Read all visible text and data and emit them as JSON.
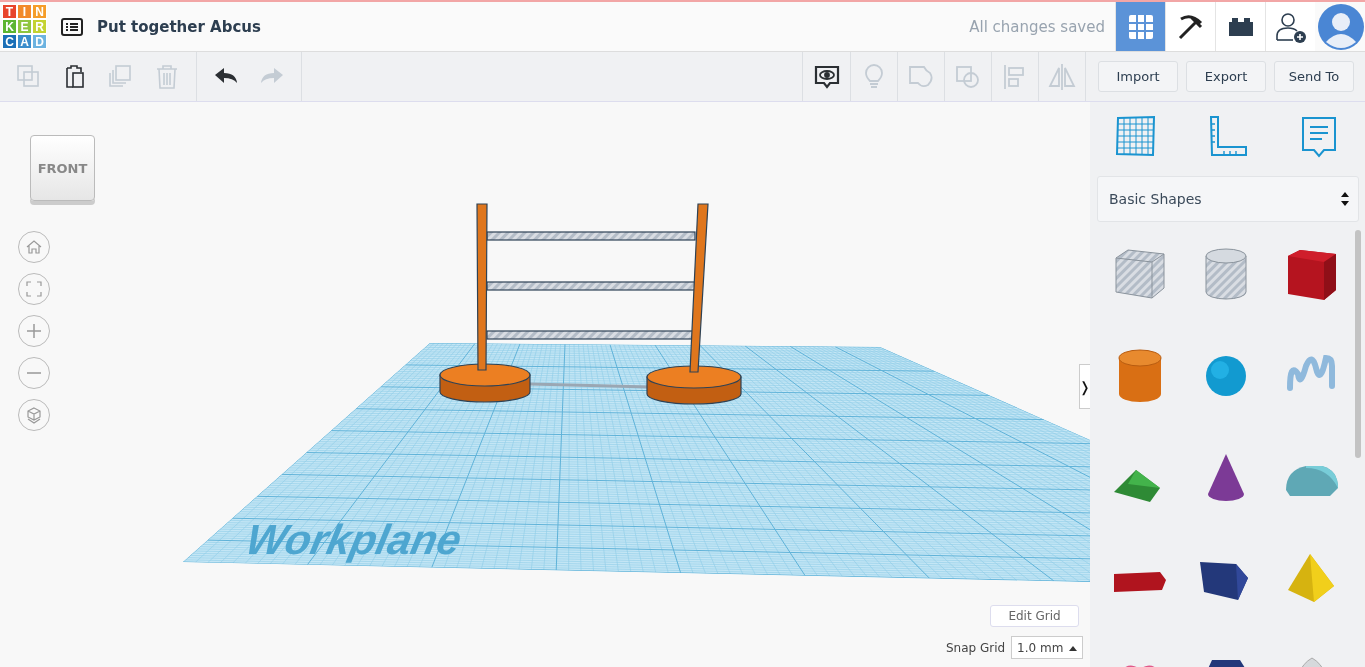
{
  "header": {
    "logo": [
      "T",
      "I",
      "N",
      "K",
      "E",
      "R",
      "C",
      "A",
      "D"
    ],
    "title": "Put together Abcus",
    "save_status": "All changes saved",
    "views": [
      {
        "kind": "grid",
        "selected": true
      },
      {
        "kind": "pickaxe",
        "selected": false
      },
      {
        "kind": "brick",
        "selected": false
      }
    ]
  },
  "toolbar": {
    "edit_tools": [
      {
        "kind": "copy",
        "disabled": true
      },
      {
        "kind": "paste",
        "disabled": false
      },
      {
        "kind": "duplicate",
        "disabled": true
      },
      {
        "kind": "delete",
        "disabled": true
      }
    ],
    "history_tools": [
      {
        "kind": "undo",
        "disabled": false
      },
      {
        "kind": "redo",
        "disabled": true
      }
    ],
    "view_tools": [
      {
        "kind": "notes",
        "disabled": false
      },
      {
        "kind": "light",
        "disabled": true
      },
      {
        "kind": "group",
        "disabled": true
      },
      {
        "kind": "ungroup",
        "disabled": true
      },
      {
        "kind": "align",
        "disabled": true
      },
      {
        "kind": "mirror",
        "disabled": true
      }
    ],
    "buttons": [
      "Import",
      "Export",
      "Send To"
    ]
  },
  "viewport": {
    "view_cube": "FRONT",
    "nav": [
      {
        "kind": "home"
      },
      {
        "kind": "fit"
      },
      {
        "kind": "zoom-in"
      },
      {
        "kind": "zoom-out"
      },
      {
        "kind": "perspective"
      }
    ],
    "workplane_label": "Workplane",
    "edit_grid": "Edit Grid",
    "snap_grid": {
      "label": "Snap Grid",
      "value": "1.0 mm"
    },
    "panel_toggle": "❭"
  },
  "panel": {
    "tools": [
      {
        "kind": "workplane"
      },
      {
        "kind": "ruler"
      },
      {
        "kind": "notes"
      }
    ],
    "category": "Basic Shapes",
    "shapes": [
      {
        "kind": "box-hole"
      },
      {
        "kind": "cylinder-hole"
      },
      {
        "kind": "box"
      },
      {
        "kind": "cylinder"
      },
      {
        "kind": "sphere"
      },
      {
        "kind": "scribble"
      },
      {
        "kind": "roof"
      },
      {
        "kind": "cone"
      },
      {
        "kind": "round-roof"
      },
      {
        "kind": "text"
      },
      {
        "kind": "polygon"
      },
      {
        "kind": "pyramid"
      },
      {
        "kind": "heart"
      },
      {
        "kind": "hexagon"
      },
      {
        "kind": "paraboloid"
      }
    ]
  }
}
